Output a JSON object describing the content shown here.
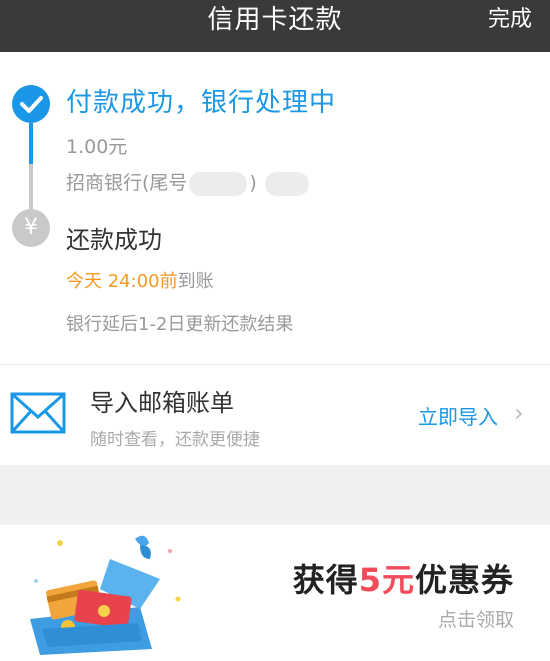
{
  "navbar": {
    "title": "信用卡还款",
    "done_label": "完成"
  },
  "progress": {
    "step1": {
      "title": "付款成功，银行处理中",
      "amount": "1.00元",
      "bank_prefix": "招商银行(尾号",
      "bank_suffix": ")"
    },
    "step2": {
      "title": "还款成功",
      "eta_highlight": "今天 24:00前",
      "eta_suffix": "到账",
      "note": "银行延后1-2日更新还款结果"
    }
  },
  "import": {
    "title": "导入邮箱账单",
    "subtitle": "随时查看，还款更便捷",
    "action_label": "立即导入"
  },
  "promo": {
    "title_prefix": "获得",
    "title_highlight": "5元",
    "title_suffix": "优惠券",
    "subtitle": "点击领取"
  },
  "colors": {
    "accent": "#1a97e6",
    "highlight": "#f29a21",
    "promo_red": "#f24b5a",
    "navbar": "#3a3a3a"
  },
  "icons": {
    "step1": "check-icon",
    "step2": "yen-icon",
    "import": "mail-icon",
    "promo": "gift-box-icon",
    "chevron": "chevron-right-icon"
  }
}
